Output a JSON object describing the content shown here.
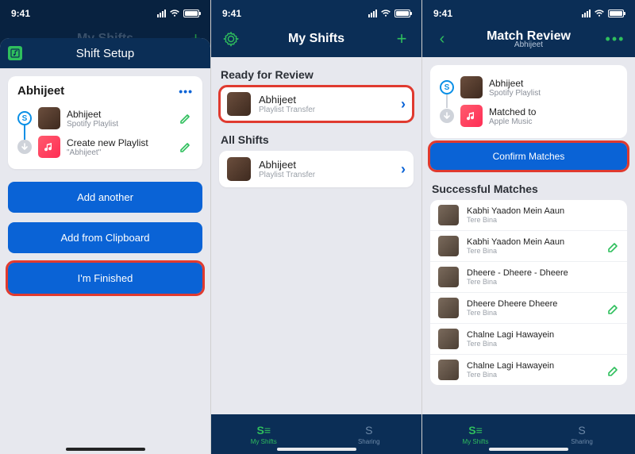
{
  "statusbar": {
    "time": "9:41"
  },
  "screen1": {
    "base_title": "My Shifts",
    "modal_title": "Shift Setup",
    "card_title": "Abhijeet",
    "source": {
      "title": "Abhijeet",
      "subtitle": "Spotify Playlist"
    },
    "dest": {
      "title": "Create new Playlist",
      "subtitle": "\"Abhijeet\""
    },
    "btn_add_another": "Add another",
    "btn_add_clipboard": "Add from Clipboard",
    "btn_finished": "I'm Finished"
  },
  "screen2": {
    "title": "My Shifts",
    "section_ready": "Ready for Review",
    "section_all": "All Shifts",
    "ready_item": {
      "title": "Abhijeet",
      "subtitle": "Playlist Transfer"
    },
    "all_item": {
      "title": "Abhijeet",
      "subtitle": "Playlist Transfer"
    },
    "tab_shifts": "My Shifts",
    "tab_sharing": "Sharing"
  },
  "screen3": {
    "title": "Match Review",
    "subtitle": "Abhijeet",
    "source": {
      "title": "Abhijeet",
      "subtitle": "Spotify Playlist"
    },
    "dest": {
      "title": "Matched to",
      "subtitle": "Apple Music"
    },
    "btn_confirm": "Confirm Matches",
    "section_success": "Successful Matches",
    "songs": [
      {
        "title": "Kabhi Yaadon Mein Aaun",
        "artist": "Tere Bina",
        "matched": false
      },
      {
        "title": "Kabhi Yaadon Mein Aaun",
        "artist": "Tere Bina",
        "matched": true
      },
      {
        "title": "Dheere - Dheere - Dheere",
        "artist": "Tere Bina",
        "matched": false
      },
      {
        "title": "Dheere Dheere Dheere",
        "artist": "Tere Bina",
        "matched": true
      },
      {
        "title": "Chalne Lagi Hawayein",
        "artist": "Tere Bina",
        "matched": false
      },
      {
        "title": "Chalne Lagi Hawayein",
        "artist": "Tere Bina",
        "matched": true
      }
    ],
    "tab_shifts": "My Shifts",
    "tab_sharing": "Sharing"
  }
}
